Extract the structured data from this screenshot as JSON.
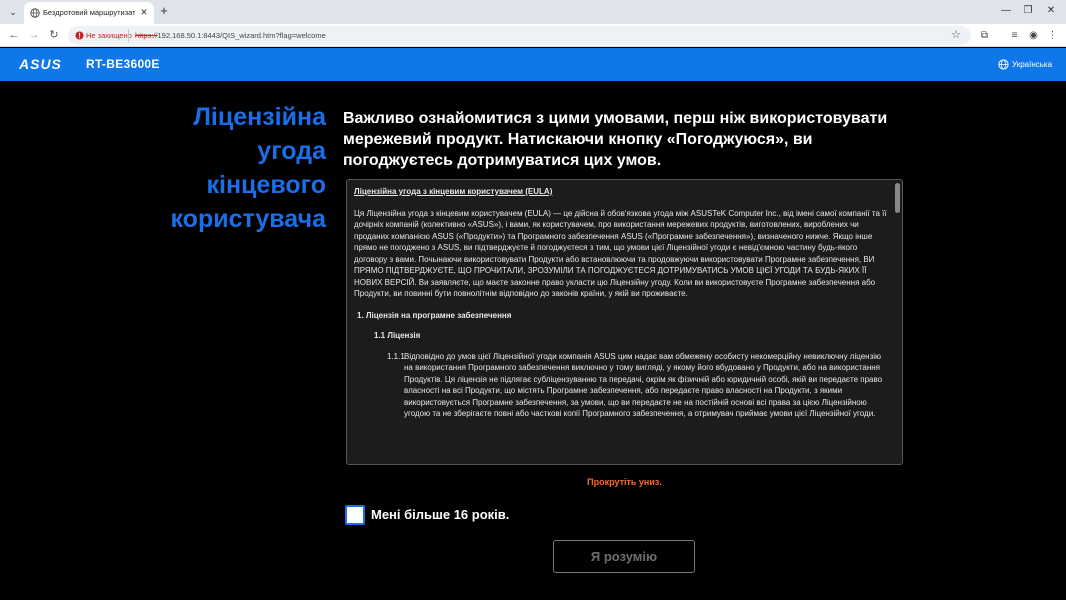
{
  "browser": {
    "tab_title": "Бездротовий маршрутизатор ASUS",
    "security_label": "Не захищено",
    "url_scheme": "https://",
    "url_rest": "192.168.50.1:8443/QIS_wizard.htm?flag=welcome",
    "icons": [
      "tab-menu-icon",
      "close-icon",
      "plus-icon",
      "back-icon",
      "forward-icon",
      "reload-icon",
      "warning-icon",
      "star-icon",
      "extensions-icon",
      "reading-list-icon",
      "profile-icon",
      "more-icon",
      "minimize-icon",
      "maximize-icon"
    ]
  },
  "header": {
    "logo_text": "ASUS",
    "model": "RT-BE3600E",
    "language": "Українська",
    "accent": "#0f77e9"
  },
  "main": {
    "page_title": "Ліцензійна угода кінцевого користувача",
    "lead": "Важливо ознайомитися з цими умовами, перш ніж використовувати мережевий продукт. Натискаючи кнопку «Погоджуюся», ви погоджуєтесь дотримуватися цих умов.",
    "eula": {
      "heading": "Ліцензійна угода з кінцевим користувачем (EULA)",
      "intro": "Ця Ліцензійна угода з кінцевим користувачем (EULA) — це дійсна й обов'язкова угода між ASUSTeK Computer Inc., від імені самої компанії та її дочірніх компаній (колективно «ASUS»), і вами, як користувачем, про використання мережевих продуктів, виготовлених, вироблених чи проданих компанією ASUS («Продукти») та Програмного забезпечення ASUS («Програмне забезпечення»), визначеного нижче. Якщо інше прямо не погоджено з ASUS, ви підтверджуєте й погоджуєтеся з тим, що умови цієї Ліцензійної угоди є невід'ємною частину будь-якого договору з вами. Почынаючи використовувати Продукти або встановлюючи та продовжуючи використовувати Програмне забезпечення, ВИ ПРЯМО ПІДТВЕРДЖУЄТЕ, ЩО ПРОЧИТАЛИ, ЗРОЗУМІЛИ ТА ПОГОДЖУЄТЕСЯ ДОТРИМУВАТИСЬ УМОВ ЦІЄЇ УГОДИ ТА БУДЬ-ЯКИХ ЇЇ НОВИХ ВЕРСІЙ. Ви заявляєте, що маєте законне право укласти цю Ліцензійну угоду. Коли ви використовуєте Програмне забезпечення або Продукти, ви повинні бути повнолітнім відповідно до законів країни, у якій ви проживаєте.",
      "section_1": "1. Ліцензія на програмне забезпечення",
      "section_1_1": "1.1 Ліцензія",
      "item_1_1_1_num": "1.1.1",
      "item_1_1_1": "Відповідно до умов цієї Ліцензійної угоди компанія ASUS цим надає вам обмежену особисту некомерційну невиключну ліцензію на використання Програмного забезпечення виключно у тому вигляді, у якому його вбудовано у Продукти, або на використання Продуктів. Ця ліцензія не підлягає субліцензуванню та передачі, окрім як фізичній або юридичній особі, якій ви передаєте право власності на всі Продукти, що містять Програмне забезпечення, або передаєте право власності на Продукти, з якими використовується Програмне забезпечення, за умови, що ви передаєте не на постійній основі всі права за цією Ліцензійною угодою та не зберігаєте повні або часткові копії Програмного забезпечення, а отримувач приймає умови цієї Ліцензійної угоди."
    },
    "scroll_hint": "Прокрутіть униз.",
    "age_checkbox_label": "Мені більше 16 років.",
    "age_checked": false,
    "understand_button": "Я розумію",
    "title_color": "#1a6ee8",
    "hint_color": "#ff6a2b"
  }
}
